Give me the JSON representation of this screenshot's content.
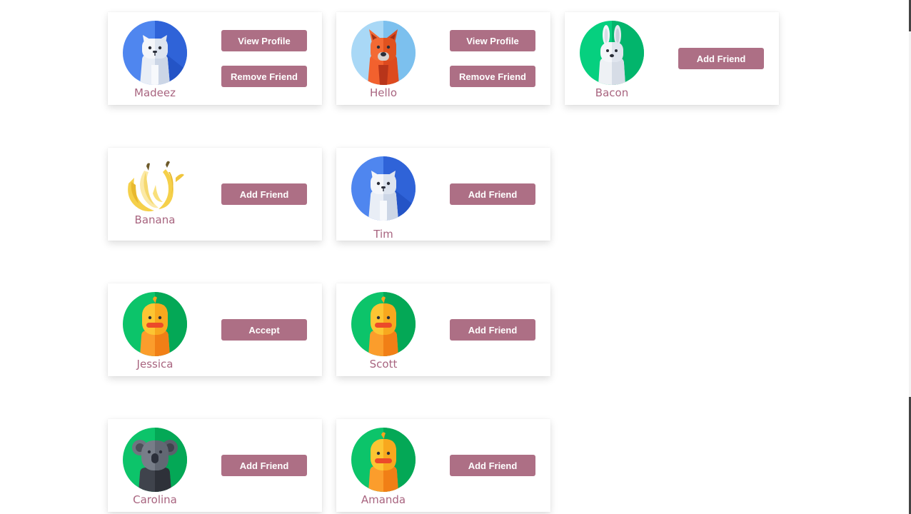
{
  "cards": [
    {
      "name": "Madeez",
      "avatar": "cat-avatar-icon",
      "buttons": [
        "View Profile",
        "Remove Friend"
      ]
    },
    {
      "name": "Hello",
      "avatar": "fox-avatar-icon",
      "buttons": [
        "View Profile",
        "Remove Friend"
      ]
    },
    {
      "name": "Bacon",
      "avatar": "rabbit-avatar-icon",
      "buttons": [
        "Add Friend"
      ]
    },
    {
      "name": "Banana",
      "avatar": "banana-avatar-icon",
      "buttons": [
        "Add Friend"
      ]
    },
    {
      "name": "Tim",
      "avatar": "cat-avatar-icon",
      "buttons": [
        "Add Friend"
      ]
    },
    {
      "name": "Jessica",
      "avatar": "duck-avatar-icon",
      "buttons": [
        "Accept"
      ]
    },
    {
      "name": "Scott",
      "avatar": "duck-avatar-icon",
      "buttons": [
        "Add Friend"
      ]
    },
    {
      "name": "Carolina",
      "avatar": "koala-avatar-icon",
      "buttons": [
        "Add Friend"
      ]
    },
    {
      "name": "Amanda",
      "avatar": "duck-avatar-icon",
      "buttons": [
        "Add Friend"
      ]
    }
  ],
  "colors": {
    "accent": "#ad6f85",
    "name_text": "#a8647f"
  }
}
